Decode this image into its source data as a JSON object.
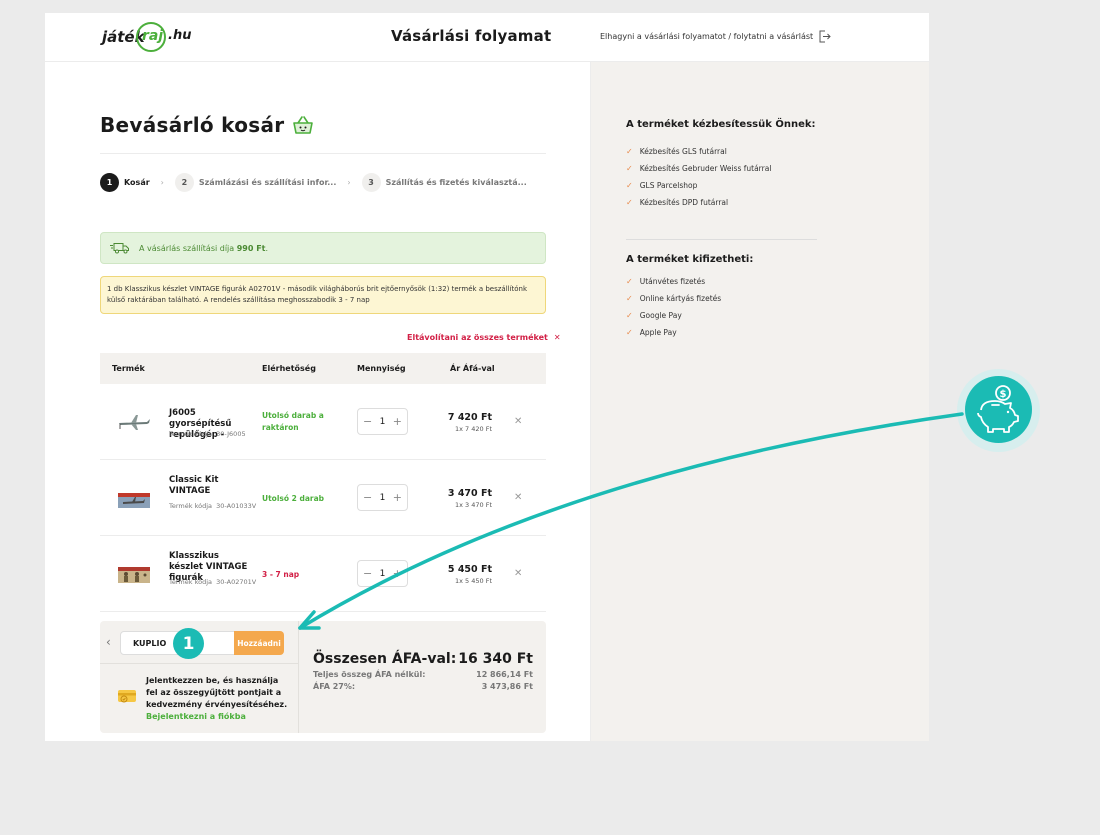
{
  "header": {
    "logo_part1": "játék",
    "logo_part2": "raj",
    "logo_part3": ".hu",
    "title": "Vásárlási folyamat",
    "leave_link": "Elhagyni a vásárlási folyamatot / folytatni a vásárlást"
  },
  "cart": {
    "title": "Bevásárló kosár",
    "steps": [
      {
        "num": "1",
        "label": "Kosár"
      },
      {
        "num": "2",
        "label": "Számlázási és szállítási infor..."
      },
      {
        "num": "3",
        "label": "Szállítás és fizetés kiválasztá..."
      }
    ],
    "shipping_notice_prefix": "A vásárlás szállítási díja",
    "shipping_notice_amount": "990 Ft",
    "shipping_notice_suffix": ".",
    "warning_notice": "1 db Klasszikus készlet VINTAGE figurák A02701V - második világháborús brit ejtőernyősök (1:32) termék a beszállítónk külső raktárában található. A rendelés szállítása meghosszabodik 3 - 7 nap",
    "remove_all": "Eltávolítani az összes terméket",
    "columns": {
      "product": "Termék",
      "availability": "Elérhetőség",
      "quantity": "Mennyiség",
      "price": "Ár Áfá-val"
    },
    "items": [
      {
        "name": "J6005 gyorsépítésű repülőgép -",
        "code_label": "Termék kódja",
        "code": "30-J6005",
        "availability": "Utolsó darab a raktáron",
        "qty": "1",
        "price": "7 420 Ft",
        "unit_price": "1x 7 420 Ft"
      },
      {
        "name": "Classic Kit VINTAGE",
        "code_label": "Termék kódja",
        "code": "30-A01033V",
        "availability": "Utolsó 2 darab",
        "qty": "1",
        "price": "3 470 Ft",
        "unit_price": "1x 3 470 Ft"
      },
      {
        "name": "Klasszikus készlet VINTAGE figurák",
        "code_label": "Termék kódja",
        "code": "30-A02701V",
        "availability": "3 - 7 nap",
        "qty": "1",
        "price": "5 450 Ft",
        "unit_price": "1x 5 450 Ft"
      }
    ]
  },
  "summary": {
    "coupon_value": "KUPLIO",
    "coupon_button": "Hozzáadni",
    "step_badge": "1",
    "login_text": "Jelentkezzen be, és használja fel az összegyűjtött pontjait a kedvezmény érvényesítéséhez.",
    "login_link": "Bejelentkezni a fiókba",
    "total_label": "Összesen ÁFA-val:",
    "total_value": "16 340 Ft",
    "net_label": "Teljes összeg ÁFA nélkül:",
    "net_value": "12 866,14 Ft",
    "vat_label": "ÁFA 27%:",
    "vat_value": "3 473,86 Ft"
  },
  "sidebar": {
    "delivery_heading": "A terméket kézbesítessük Önnek:",
    "delivery_options": [
      "Kézbesítés GLS futárral",
      "Kézbesítés Gebruder Weiss futárral",
      "GLS Parcelshop",
      "Kézbesítés DPD futárral"
    ],
    "payment_heading": "A terméket kifizetheti:",
    "payment_options": [
      "Utánvétes fizetés",
      "Online kártyás fizetés",
      "Google Pay",
      "Apple Pay"
    ]
  },
  "colors": {
    "brand_green": "#4caf3c",
    "alert_red": "#d21f45",
    "coupon_orange": "#f4a84d",
    "accent_teal": "#1bbbb4"
  }
}
